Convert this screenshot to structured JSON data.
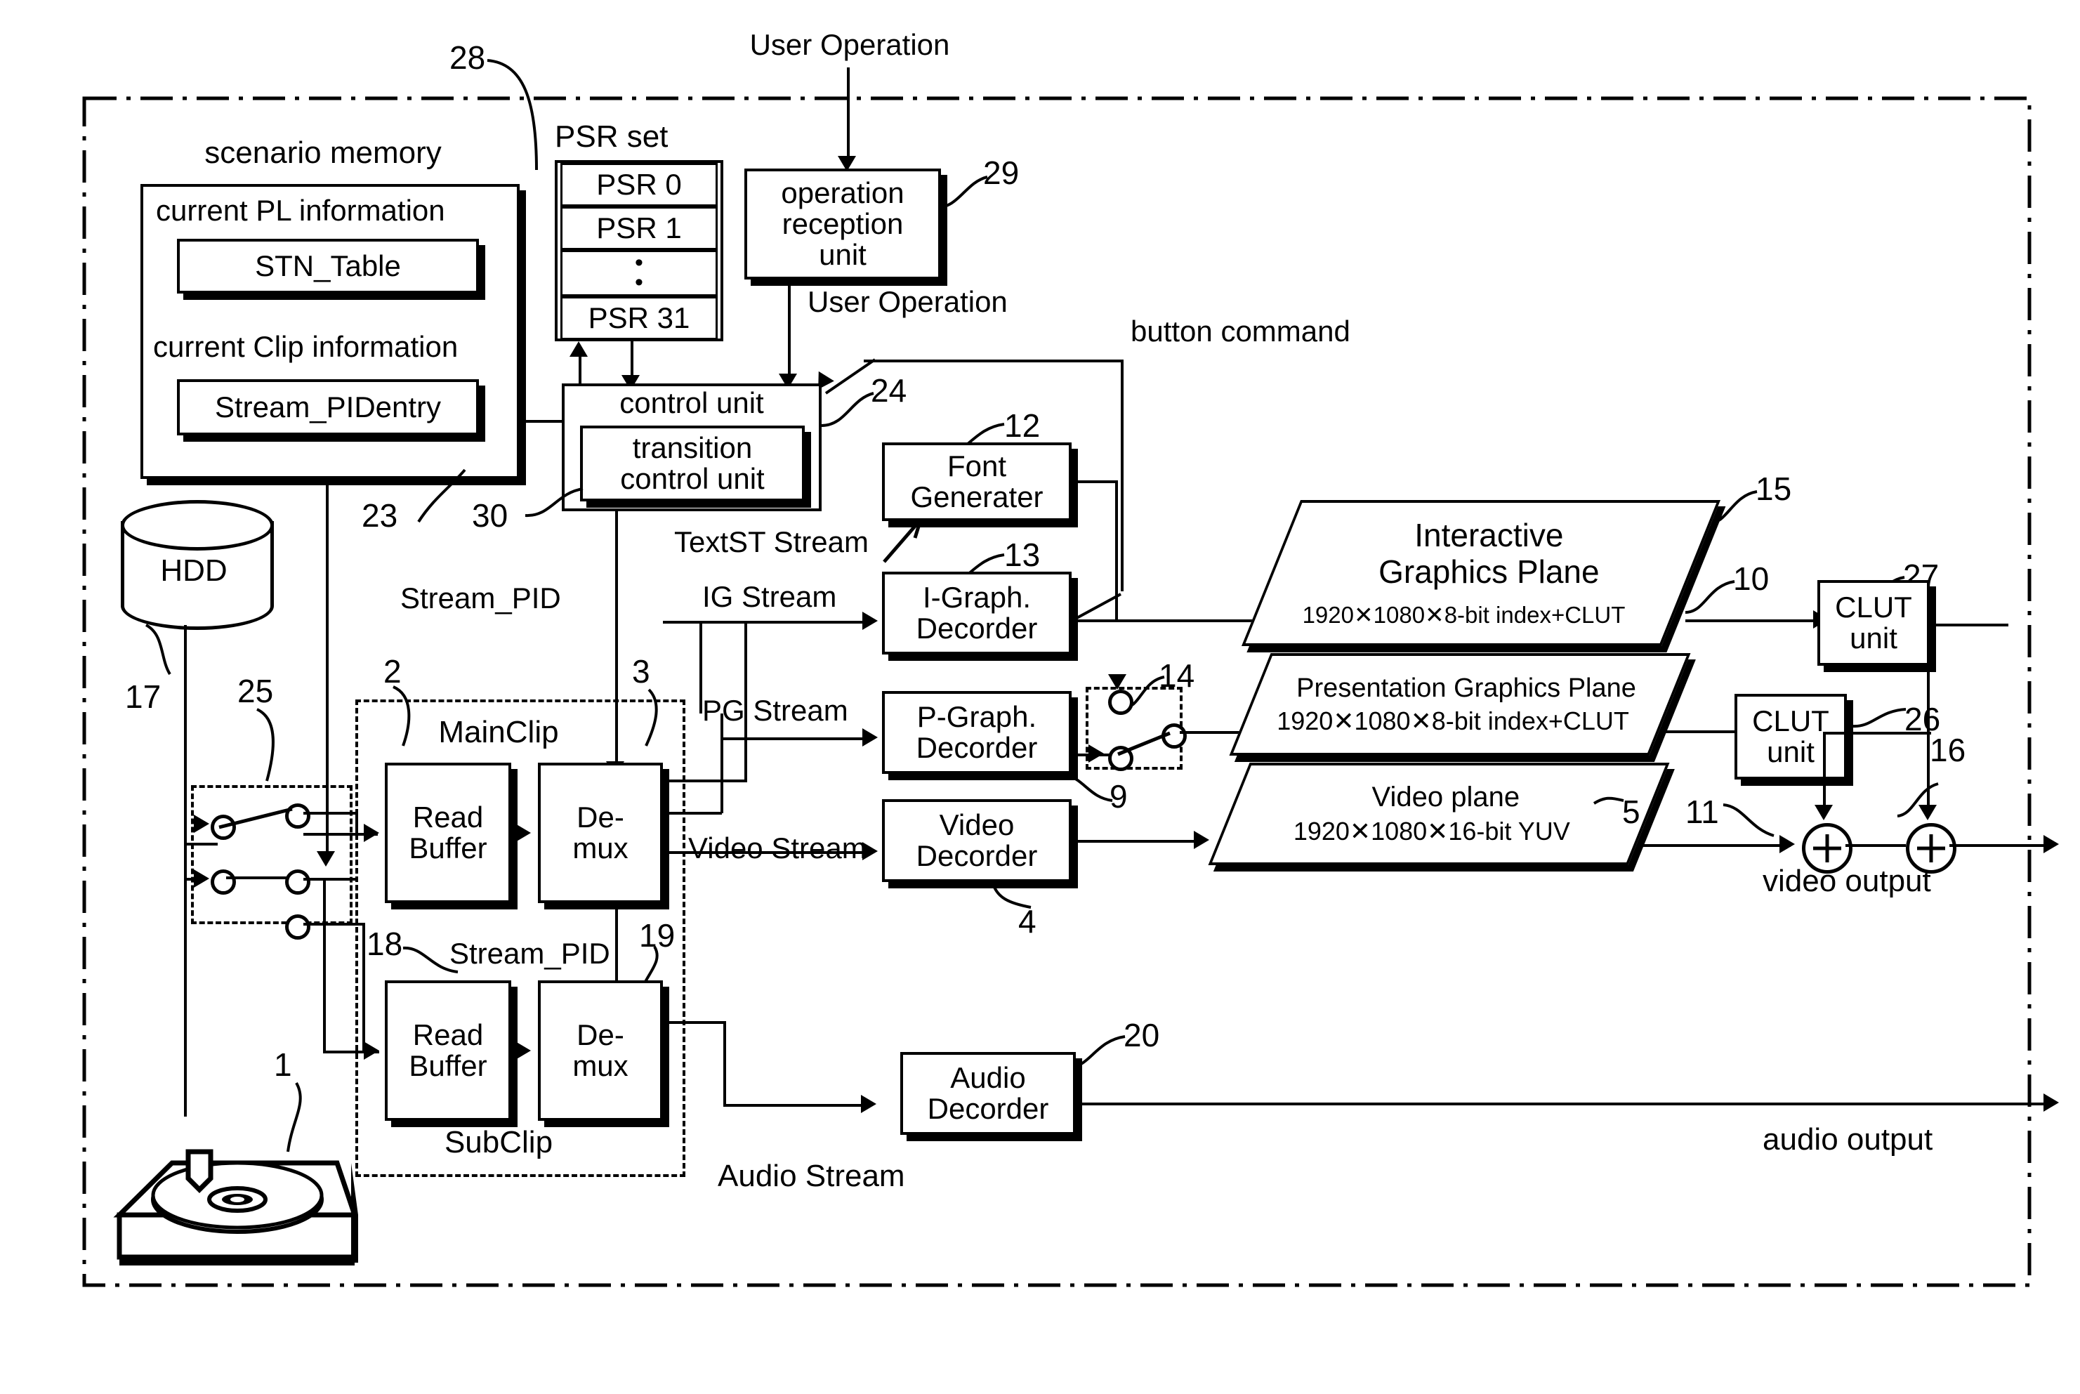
{
  "diagram": {
    "title": "Playback apparatus block diagram",
    "external_labels": {
      "user_operation_top": "User Operation",
      "user_operation_mid": "User Operation",
      "button_command": "button command",
      "video_output": "video output",
      "audio_output": "audio output"
    },
    "blocks": {
      "scenario_memory": "scenario memory",
      "current_pl_information": "current PL information",
      "stn_table": "STN_Table",
      "current_clip_information": "current Clip information",
      "stream_pidentry": "Stream_PIDentry",
      "psr_set": "PSR set",
      "psr_0": "PSR 0",
      "psr_1": "PSR 1",
      "psr_dots": "•\n•",
      "psr_31": "PSR 31",
      "operation_reception_unit": "operation\nreception\nunit",
      "control_unit": "control unit",
      "transition_control_unit": "transition\ncontrol unit",
      "font_generater": "Font\nGenerater",
      "i_graph_decorder": "I-Graph.\nDecorder",
      "p_graph_decorder": "P-Graph.\nDecorder",
      "video_decorder": "Video\nDecorder",
      "audio_decorder": "Audio\nDecorder",
      "clut_unit_top": "CLUT\nunit",
      "clut_unit_bottom": "CLUT\nunit",
      "read_buffer_main": "Read\nBuffer",
      "demux_main": "De-\nmux",
      "read_buffer_sub": "Read\nBuffer",
      "demux_sub": "De-\nmux",
      "hdd": "HDD",
      "mainclip": "MainClip",
      "subclip": "SubClip"
    },
    "planes": {
      "interactive_graphics": {
        "name": "Interactive\nGraphics Plane",
        "spec": "1920✕1080✕8-bit index+CLUT"
      },
      "presentation_graphics": {
        "name": "Presentation Graphics Plane",
        "spec": "1920✕1080✕8-bit index+CLUT"
      },
      "video": {
        "name": "Video plane",
        "spec": "1920✕1080✕16-bit YUV"
      }
    },
    "stream_labels": {
      "textst_stream": "TextST Stream",
      "ig_stream": "IG Stream",
      "pg_stream": "PG Stream",
      "video_stream": "Video Stream",
      "audio_stream": "Audio Stream",
      "stream_pid_main": "Stream_PID",
      "stream_pid_sub": "Stream_PID"
    },
    "reference_numerals": {
      "n1": "1",
      "n2": "2",
      "n3": "3",
      "n4": "4",
      "n5": "5",
      "n9": "9",
      "n10": "10",
      "n11": "11",
      "n12": "12",
      "n13": "13",
      "n14": "14",
      "n15": "15",
      "n16": "16",
      "n17": "17",
      "n18": "18",
      "n19": "19",
      "n20": "20",
      "n23": "23",
      "n24": "24",
      "n25": "25",
      "n26": "26",
      "n27": "27",
      "n28": "28",
      "n29": "29",
      "n30": "30"
    },
    "colors": {
      "line": "#000000",
      "background": "#ffffff"
    }
  }
}
